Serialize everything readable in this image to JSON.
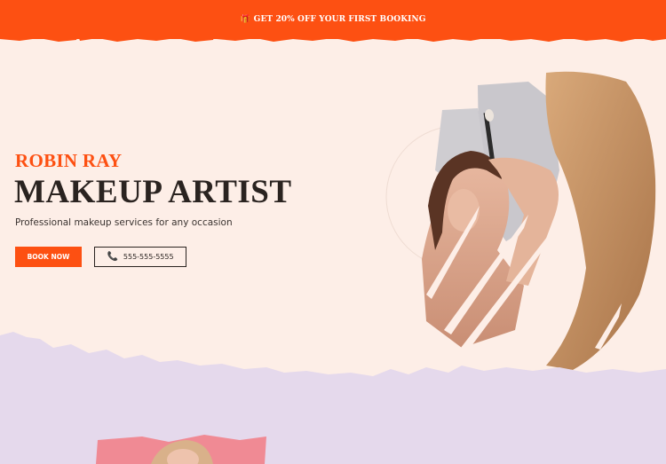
{
  "promo": {
    "icon": "gift-icon",
    "text": "GET 20% OFF YOUR FIRST BOOKING"
  },
  "hero": {
    "subtitle": "ROBIN RAY",
    "title": "MAKEUP ARTIST",
    "description": "Professional makeup services for any occasion",
    "book_label": "BOOK NOW",
    "phone_icon": "phone-icon",
    "phone_number": "555-555-5555"
  },
  "colors": {
    "accent": "#fd5012",
    "background": "#fdeee7",
    "lavender": "#e5d9ec",
    "text_dark": "#2a2320"
  }
}
